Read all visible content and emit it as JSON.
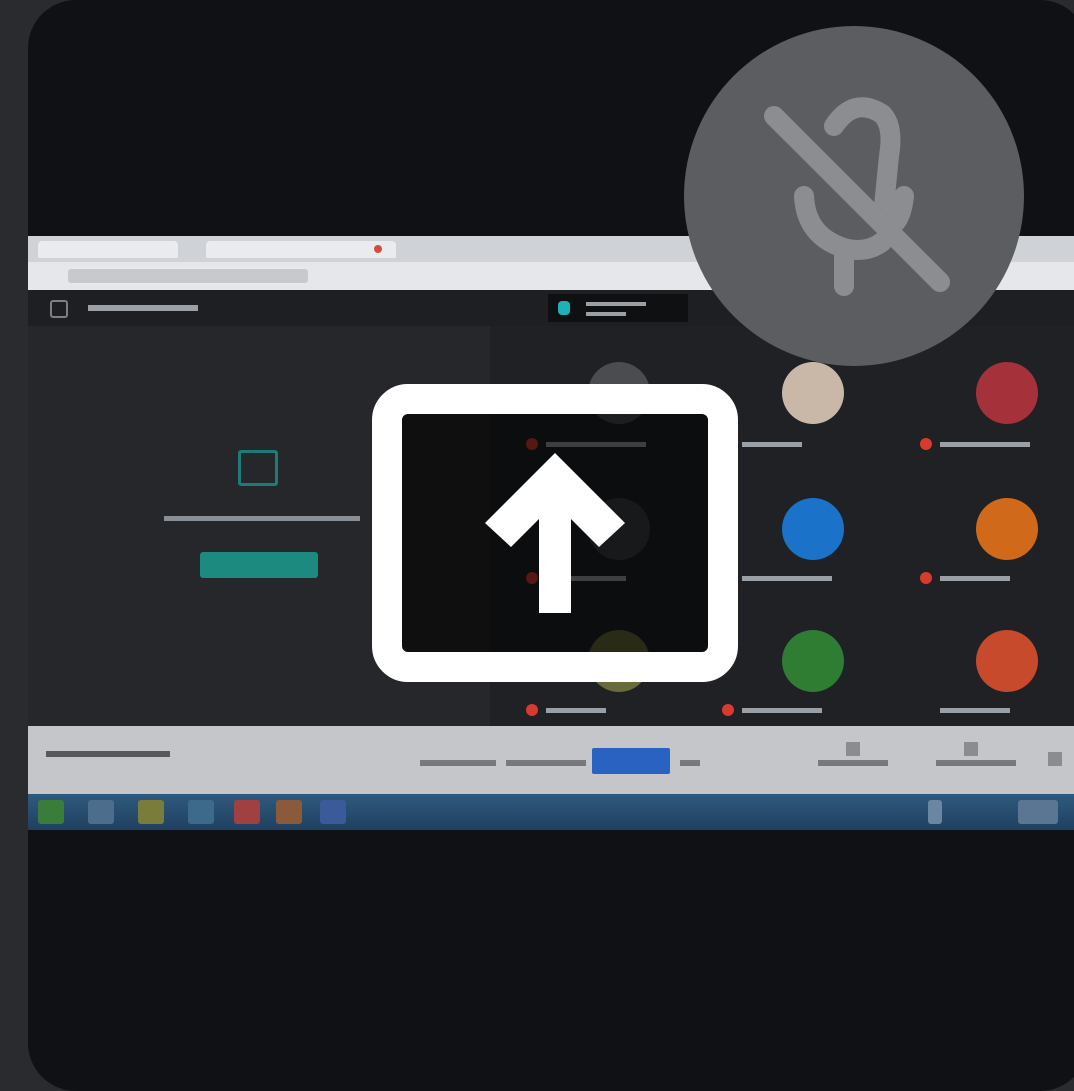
{
  "tile": {
    "colors": {
      "background": "#101114",
      "page": "#2a2b2e"
    }
  },
  "overlay": {
    "share_icon": "present-screen-icon",
    "mute_icon": "mic-off-icon",
    "colors": {
      "share_icon": "#ffffff",
      "mute_badge": "#5b5d60",
      "mute_glyph": "#8b8d90"
    }
  },
  "shared_screen": {
    "accent_colors": {
      "present_button": "#1c8a7f",
      "taskbar": "#2f5a7e",
      "participant_blue": "#1a73c8",
      "participant_orange": "#d06a1a",
      "participant_green": "#2e7d32",
      "participant_red": "#c74a2c",
      "bottom_chip": "#2a62c2"
    }
  }
}
